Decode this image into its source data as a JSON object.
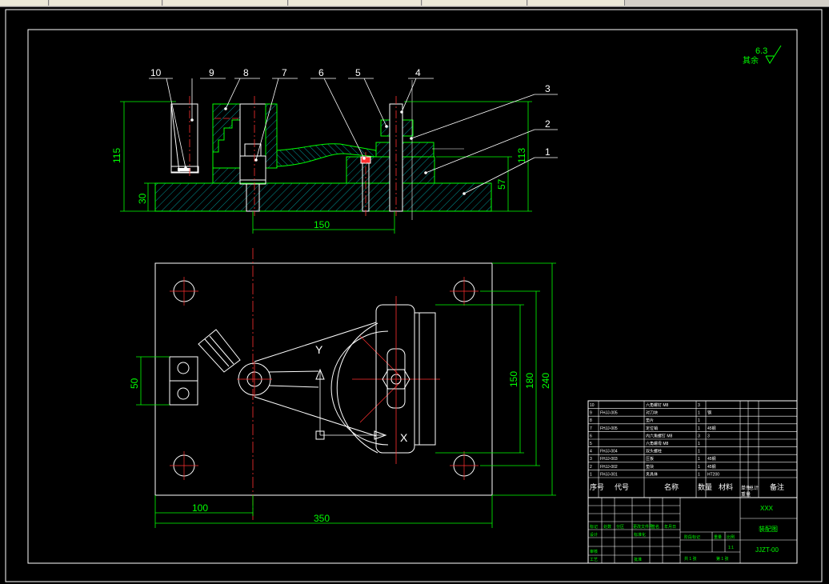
{
  "window": {
    "tabs": [
      "",
      "",
      "",
      "",
      "",
      ""
    ]
  },
  "drawing": {
    "surface_finish": {
      "value": "6.3",
      "label": "其余"
    },
    "front_view": {
      "balloons": [
        "10",
        "9",
        "8",
        "7",
        "6",
        "5",
        "4",
        "3",
        "2",
        "1"
      ],
      "dims": {
        "overall_height": "115",
        "base_height": "30",
        "span": "150",
        "right_height": "113",
        "right_sub": "57"
      }
    },
    "top_view": {
      "dims": {
        "width": "350",
        "offset": "100",
        "left_block": "50",
        "h1": "150",
        "h2": "180",
        "h3": "240"
      },
      "axis_x": "X",
      "axis_y": "Y"
    },
    "bom": {
      "headers": [
        "序号",
        "代号",
        "名称",
        "数量",
        "材料",
        "单件",
        "总计",
        "备注"
      ],
      "headers2": [
        "",
        "",
        "",
        "",
        "",
        "重量",
        "",
        ""
      ],
      "rows": [
        {
          "no": "10",
          "code": "",
          "name": "六角螺钉 M8",
          "qty": "3",
          "mat": ""
        },
        {
          "no": "9",
          "code": "FHJJ-005",
          "name": "对刀块",
          "qty": "1",
          "mat": "钢"
        },
        {
          "no": "8",
          "code": "",
          "name": "垫片",
          "qty": "1",
          "mat": ""
        },
        {
          "no": "7",
          "code": "FHJJ-005",
          "name": "定位销",
          "qty": "1",
          "mat": "45钢"
        },
        {
          "no": "6",
          "code": "",
          "name": "内六角螺钉 M8",
          "qty": "3",
          "mat": "3"
        },
        {
          "no": "5",
          "code": "",
          "name": "六角螺母 M8",
          "qty": "1",
          "mat": ""
        },
        {
          "no": "4",
          "code": "FHJJ-004",
          "name": "双头螺柱",
          "qty": "1",
          "mat": ""
        },
        {
          "no": "3",
          "code": "FHJJ-003",
          "name": "压板",
          "qty": "1",
          "mat": "45钢"
        },
        {
          "no": "2",
          "code": "FHJJ-002",
          "name": "垫块",
          "qty": "1",
          "mat": "45钢"
        },
        {
          "no": "1",
          "code": "FHJJ-001",
          "name": "夹具体",
          "qty": "1",
          "mat": "HT200"
        }
      ]
    },
    "title_block": {
      "company": "XXX",
      "drawing_name": "装配图",
      "drawing_no": "JJZT-00",
      "row_labels": [
        "标记",
        "处数",
        "分区",
        "更改文件号",
        "签名",
        "年月日"
      ],
      "left_labels": [
        "设计",
        "审核",
        "工艺"
      ],
      "std_label": "标准化",
      "approve_label": "批准",
      "stage_label": "阶段标记",
      "weight_label": "重量",
      "scale_label": "比例",
      "scale": "1:1",
      "sheet_total": "共 1 张",
      "sheet_no": "第 1 张"
    }
  }
}
